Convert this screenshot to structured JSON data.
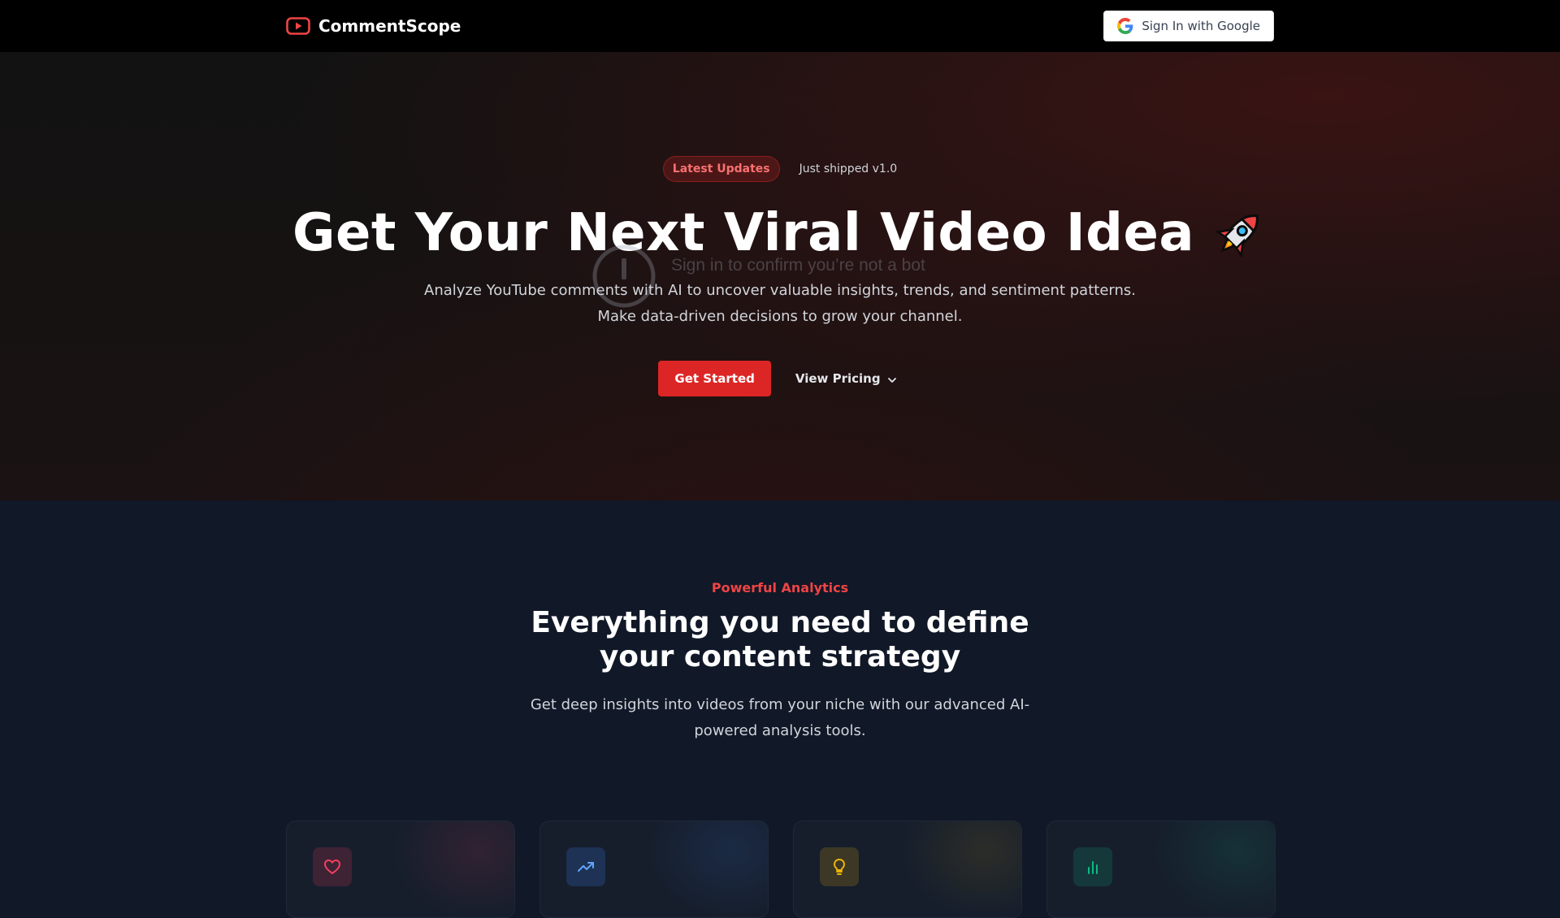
{
  "navbar": {
    "brand_name": "CommentScope",
    "sign_in_label": "Sign In with Google"
  },
  "hero": {
    "badge": "Latest Updates",
    "badge_note": "Just shipped v1.0",
    "title": "Get Your Next Viral Video Idea",
    "subtitle_line1": "Analyze YouTube comments with AI to uncover valuable insights, trends, and sentiment patterns.",
    "subtitle_line2": "Make data-driven decisions to grow your channel.",
    "primary_cta": "Get Started",
    "secondary_cta": "View Pricing",
    "overlay_text": "Sign in to confirm you’re not a bot"
  },
  "features": {
    "eyebrow": "Powerful Analytics",
    "title_line1": "Everything you need to define",
    "title_line2": "your content strategy",
    "subtitle_line1": "Get deep insights into videos from your niche with our advanced AI-",
    "subtitle_line2": "powered analysis tools.",
    "cards": [
      {
        "icon": "heart-icon",
        "color": "#f43f5e"
      },
      {
        "icon": "trending-up-icon",
        "color": "#3b82f6"
      },
      {
        "icon": "lightbulb-icon",
        "color": "#eab308"
      },
      {
        "icon": "bar-chart-icon",
        "color": "#10b981"
      }
    ]
  },
  "colors": {
    "accent": "#dc2626",
    "navbar_bg": "#000000",
    "section_bg": "#111827"
  }
}
